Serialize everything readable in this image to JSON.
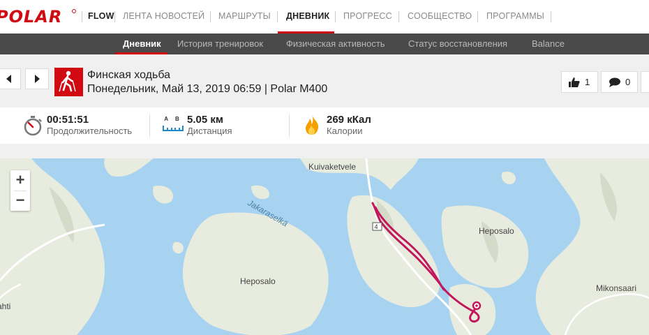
{
  "brand": {
    "logo_text": "POLAR",
    "flow_label": "FLOW"
  },
  "topnav": {
    "items": [
      {
        "label": "ЛЕНТА НОВОСТЕЙ"
      },
      {
        "label": "МАРШРУТЫ"
      },
      {
        "label": "ДНЕВНИК"
      },
      {
        "label": "ПРОГРЕСС"
      },
      {
        "label": "СООБЩЕСТВО"
      },
      {
        "label": "ПРОГРАММЫ"
      }
    ],
    "active": "ДНЕВНИК"
  },
  "subnav": {
    "items": [
      {
        "label": "Дневник"
      },
      {
        "label": "История тренировок"
      },
      {
        "label": "Физическая активность"
      },
      {
        "label": "Статус восстановления"
      },
      {
        "label": "Balance"
      }
    ],
    "active": "Дневник"
  },
  "session": {
    "title": "Финская ходьба",
    "subtitle": "Понедельник, Май 13, 2019 06:59 | Polar M400",
    "likes": "1",
    "comments": "0"
  },
  "stats": {
    "duration": {
      "value": "00:51:51",
      "label": "Продолжительность"
    },
    "distance": {
      "value": "5.05 км",
      "label": "Дистанция",
      "icon_letters": "A B"
    },
    "calories": {
      "value": "269 кКал",
      "label": "Калории"
    }
  },
  "map": {
    "labels": {
      "kuivaketvele": "Kuivaketvele",
      "jakaraselka": "Jakaraselkä",
      "heposalo_left": "Heposalo",
      "heposalo_right": "Heposalo",
      "mikonsaari": "Mikonsaari",
      "ahti": "ahti",
      "road_number": "4"
    },
    "zoom_in": "+",
    "zoom_out": "−"
  },
  "colors": {
    "brand": "#d10a11",
    "water": "#a8d3f0",
    "land": "#e8ecdf",
    "route": "#c2185b"
  }
}
